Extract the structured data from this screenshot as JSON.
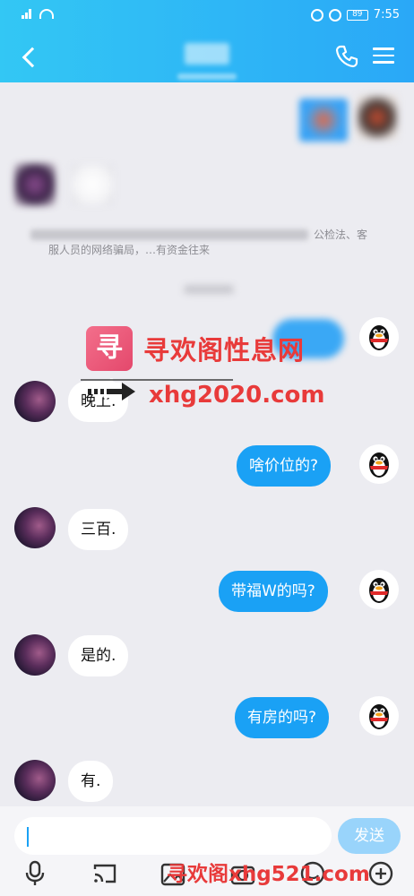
{
  "status_bar": {
    "time": "7:55",
    "battery": "89"
  },
  "watermark": {
    "logo_text": "寻欢",
    "title": "寻欢阁性息网",
    "url": "xhg2020.com",
    "bottom": "寻欢阁xhg521.com"
  },
  "notice": {
    "tail": "公检法、客",
    "line2": "服人员的网络骗局，…有资金往来"
  },
  "messages": [
    {
      "from": "other",
      "text": "晚上."
    },
    {
      "from": "me",
      "text": "啥价位的?"
    },
    {
      "from": "other",
      "text": "三百."
    },
    {
      "from": "me",
      "text": "带福W的吗?"
    },
    {
      "from": "other",
      "text": "是的."
    },
    {
      "from": "me",
      "text": "有房的吗?"
    },
    {
      "from": "other",
      "text": "有."
    }
  ],
  "input": {
    "value": "",
    "send_label": "发送"
  },
  "icons": [
    "back-icon",
    "phone-icon",
    "menu-icon",
    "microphone-icon",
    "cast-icon",
    "image-icon",
    "camera-icon",
    "emoji-icon",
    "plus-icon"
  ],
  "colors": {
    "header_start": "#33c7f4",
    "header_end": "#2aa8f7",
    "outgoing_bubble": "#1aa1f5",
    "send_button": "#99d4fb",
    "watermark": "#e83a3a"
  }
}
